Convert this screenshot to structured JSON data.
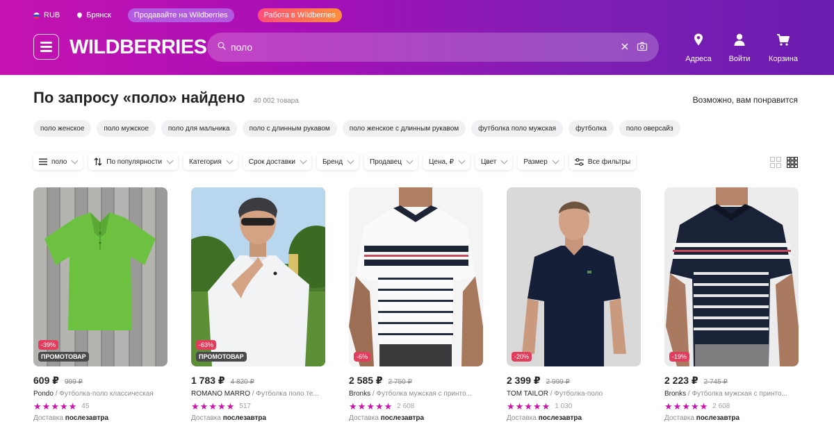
{
  "topbar": {
    "currency": "RUB",
    "city": "Брянск",
    "sell_label": "Продавайте на Wildberries",
    "work_label": "Работа в Wildberries"
  },
  "header": {
    "logo": "WILDBERRIES",
    "search_value": "поло",
    "nav": {
      "addresses": "Адреса",
      "login": "Войти",
      "cart": "Корзина"
    }
  },
  "main": {
    "title": "По запросу «поло» найдено",
    "count": "40 002 товара",
    "recommend": "Возможно, вам понравится",
    "chips": [
      "поло женское",
      "поло мужское",
      "поло для мальчика",
      "поло с длинным рукавом",
      "поло женское с длинным рукавом",
      "футболка поло мужская",
      "футболка",
      "поло оверсайз"
    ],
    "filters": {
      "query": "поло",
      "sort": "По популярности",
      "category": "Категория",
      "delivery": "Срок доставки",
      "brand": "Бренд",
      "seller": "Продавец",
      "price": "Цена, ₽",
      "color": "Цвет",
      "size": "Размер",
      "all": "Все фильтры"
    }
  },
  "products": [
    {
      "price": "609 ₽",
      "old_price": "999 ₽",
      "brand": "Pondo",
      "name": " / Футболка-поло классическая",
      "reviews": "45",
      "rating": 5,
      "discount": "-39%",
      "promo": "ПРОМОТОВАР",
      "delivery_label": "Доставка",
      "delivery": "послезавтра"
    },
    {
      "price": "1 783 ₽",
      "old_price": "4 820 ₽",
      "brand": "ROMANO MARRO",
      "name": " / Футболка поло те...",
      "reviews": "517",
      "rating": 5,
      "discount": "-63%",
      "promo": "ПРОМОТОВАР",
      "delivery_label": "Доставка",
      "delivery": "послезавтра"
    },
    {
      "price": "2 585 ₽",
      "old_price": "2 750 ₽",
      "brand": "Bronks",
      "name": " / Футболка мужская с принто...",
      "reviews": "2 608",
      "rating": 5,
      "discount": "-6%",
      "promo": "",
      "delivery_label": "Доставка",
      "delivery": "послезавтра"
    },
    {
      "price": "2 399 ₽",
      "old_price": "2 999 ₽",
      "brand": "TOM TAILOR",
      "name": " / Футболка-поло",
      "reviews": "1 030",
      "rating": 5,
      "discount": "-20%",
      "promo": "",
      "delivery_label": "Доставка",
      "delivery": "послезавтра"
    },
    {
      "price": "2 223 ₽",
      "old_price": "2 745 ₽",
      "brand": "Bronks",
      "name": " / Футболка мужская с принто...",
      "reviews": "2 608",
      "rating": 5,
      "discount": "-19%",
      "promo": "",
      "delivery_label": "Доставка",
      "delivery": "послезавтра"
    }
  ],
  "colors": {
    "accent": "#cb11ab",
    "header_start": "#c513b0",
    "header_end": "#6a1bb0",
    "discount": "#e23d5c"
  }
}
